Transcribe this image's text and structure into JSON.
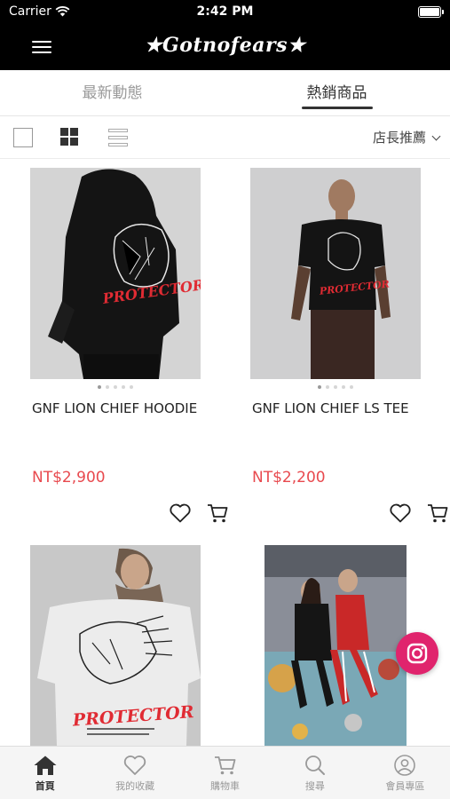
{
  "status_bar": {
    "carrier": "Carrier",
    "time": "2:42 PM"
  },
  "header": {
    "logo": "★Gotnofears★",
    "menu_icon": "hamburger-menu-icon"
  },
  "tabs": [
    {
      "label": "最新動態",
      "active": false
    },
    {
      "label": "熱銷商品",
      "active": true
    }
  ],
  "toolbar": {
    "sort_label": "店長推薦",
    "view_modes": [
      "single-view",
      "grid-view",
      "list-view"
    ],
    "active_view": "grid-view"
  },
  "products": [
    {
      "name": "GNF LION CHIEF HOODIE",
      "price": "NT$2,900"
    },
    {
      "name": "GNF LION CHIEF LS TEE",
      "price": "NT$2,200"
    },
    {
      "name": "",
      "price": ""
    },
    {
      "name": "",
      "price": ""
    }
  ],
  "product_art": {
    "print_text": "PROTECTOR",
    "print_color": "#e02b33"
  },
  "bottom_nav": [
    {
      "label": "首頁",
      "icon": "home-icon",
      "active": true
    },
    {
      "label": "我的收藏",
      "icon": "heart-icon",
      "active": false
    },
    {
      "label": "購物車",
      "icon": "cart-icon",
      "active": false
    },
    {
      "label": "搜尋",
      "icon": "search-icon",
      "active": false
    },
    {
      "label": "會員專區",
      "icon": "user-icon",
      "active": false
    }
  ],
  "colors": {
    "price": "#e8494e",
    "instagram": "#e0246d",
    "header_bg": "#000000"
  }
}
